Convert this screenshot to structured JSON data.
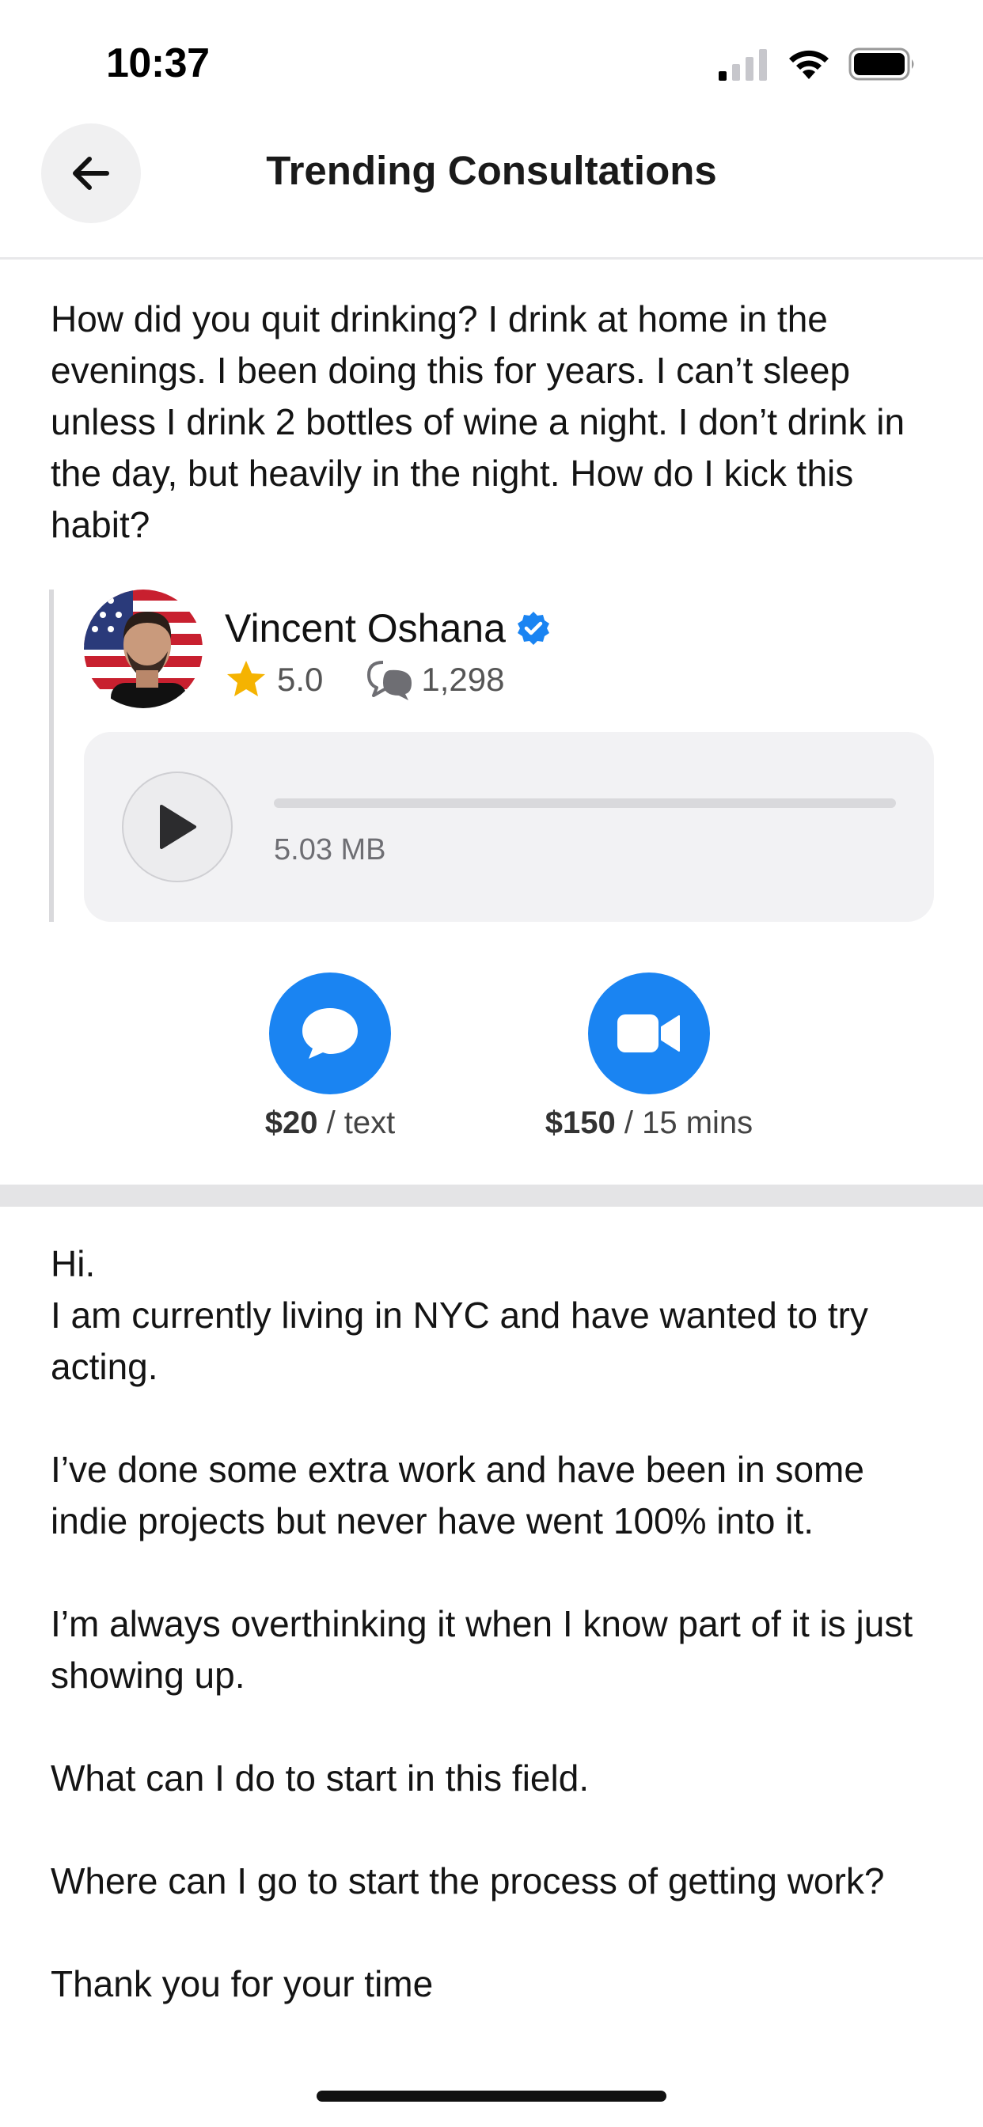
{
  "status_bar": {
    "time": "10:37"
  },
  "header": {
    "title": "Trending Consultations"
  },
  "question": {
    "text": "How did you quit drinking? I drink at home in the evenings. I been doing this for years. I can’t sleep unless I drink 2 bottles of wine a night. I don’t drink in the day, but heavily in the night. How do I kick this habit?"
  },
  "expert": {
    "name": "Vincent Oshana",
    "rating": "5.0",
    "consultations": "1,298"
  },
  "audio": {
    "file_size": "5.03 MB",
    "progress": 0
  },
  "actions": {
    "text": {
      "price": "$20",
      "unit": " / text"
    },
    "video": {
      "price": "$150",
      "unit": " / 15 mins"
    }
  },
  "consultation": {
    "text": "Hi.\nI am currently living in NYC and have wanted to try acting.\n\nI’ve done some extra work and have been in some indie projects but never have went 100% into it.\n\nI’m always overthinking it when I know part of it is just showing up.\n\nWhat can I do to start in this field.\n\nWhere can I go to start the process of getting work?\n\nThank you for your time"
  },
  "icons": {
    "accent": "#1a84f2",
    "star": "#f5b301",
    "names": [
      "back-arrow-icon",
      "verified-icon",
      "star-icon",
      "chat-bubbles-icon",
      "play-icon",
      "message-icon",
      "video-camera-icon"
    ]
  }
}
